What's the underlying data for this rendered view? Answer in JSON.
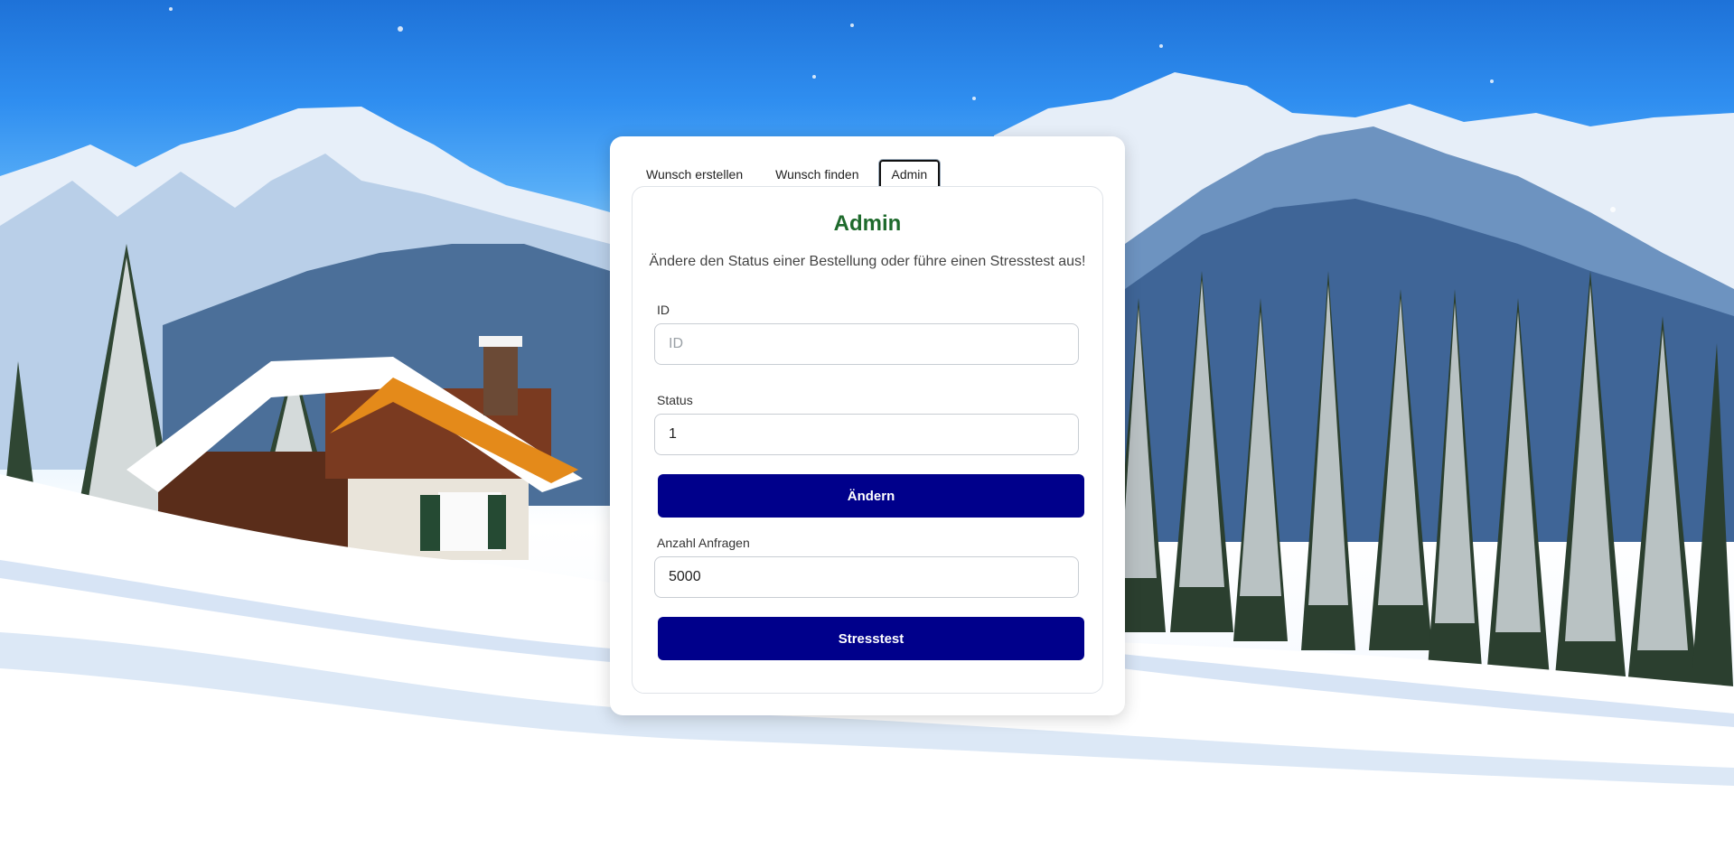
{
  "tabs": [
    {
      "label": "Wunsch erstellen",
      "active": false
    },
    {
      "label": "Wunsch finden",
      "active": false
    },
    {
      "label": "Admin",
      "active": true
    }
  ],
  "admin": {
    "title": "Admin",
    "description": "Ändere den Status einer Bestellung oder führe einen Stresstest aus!",
    "id_label": "ID",
    "id_placeholder": "ID",
    "id_value": "",
    "status_label": "Status",
    "status_value": "1",
    "change_button": "Ändern",
    "requests_label": "Anzahl Anfragen",
    "requests_value": "5000",
    "stresstest_button": "Stresstest"
  },
  "colors": {
    "title_green": "#1e6a2c",
    "button_navy": "#00008b"
  }
}
